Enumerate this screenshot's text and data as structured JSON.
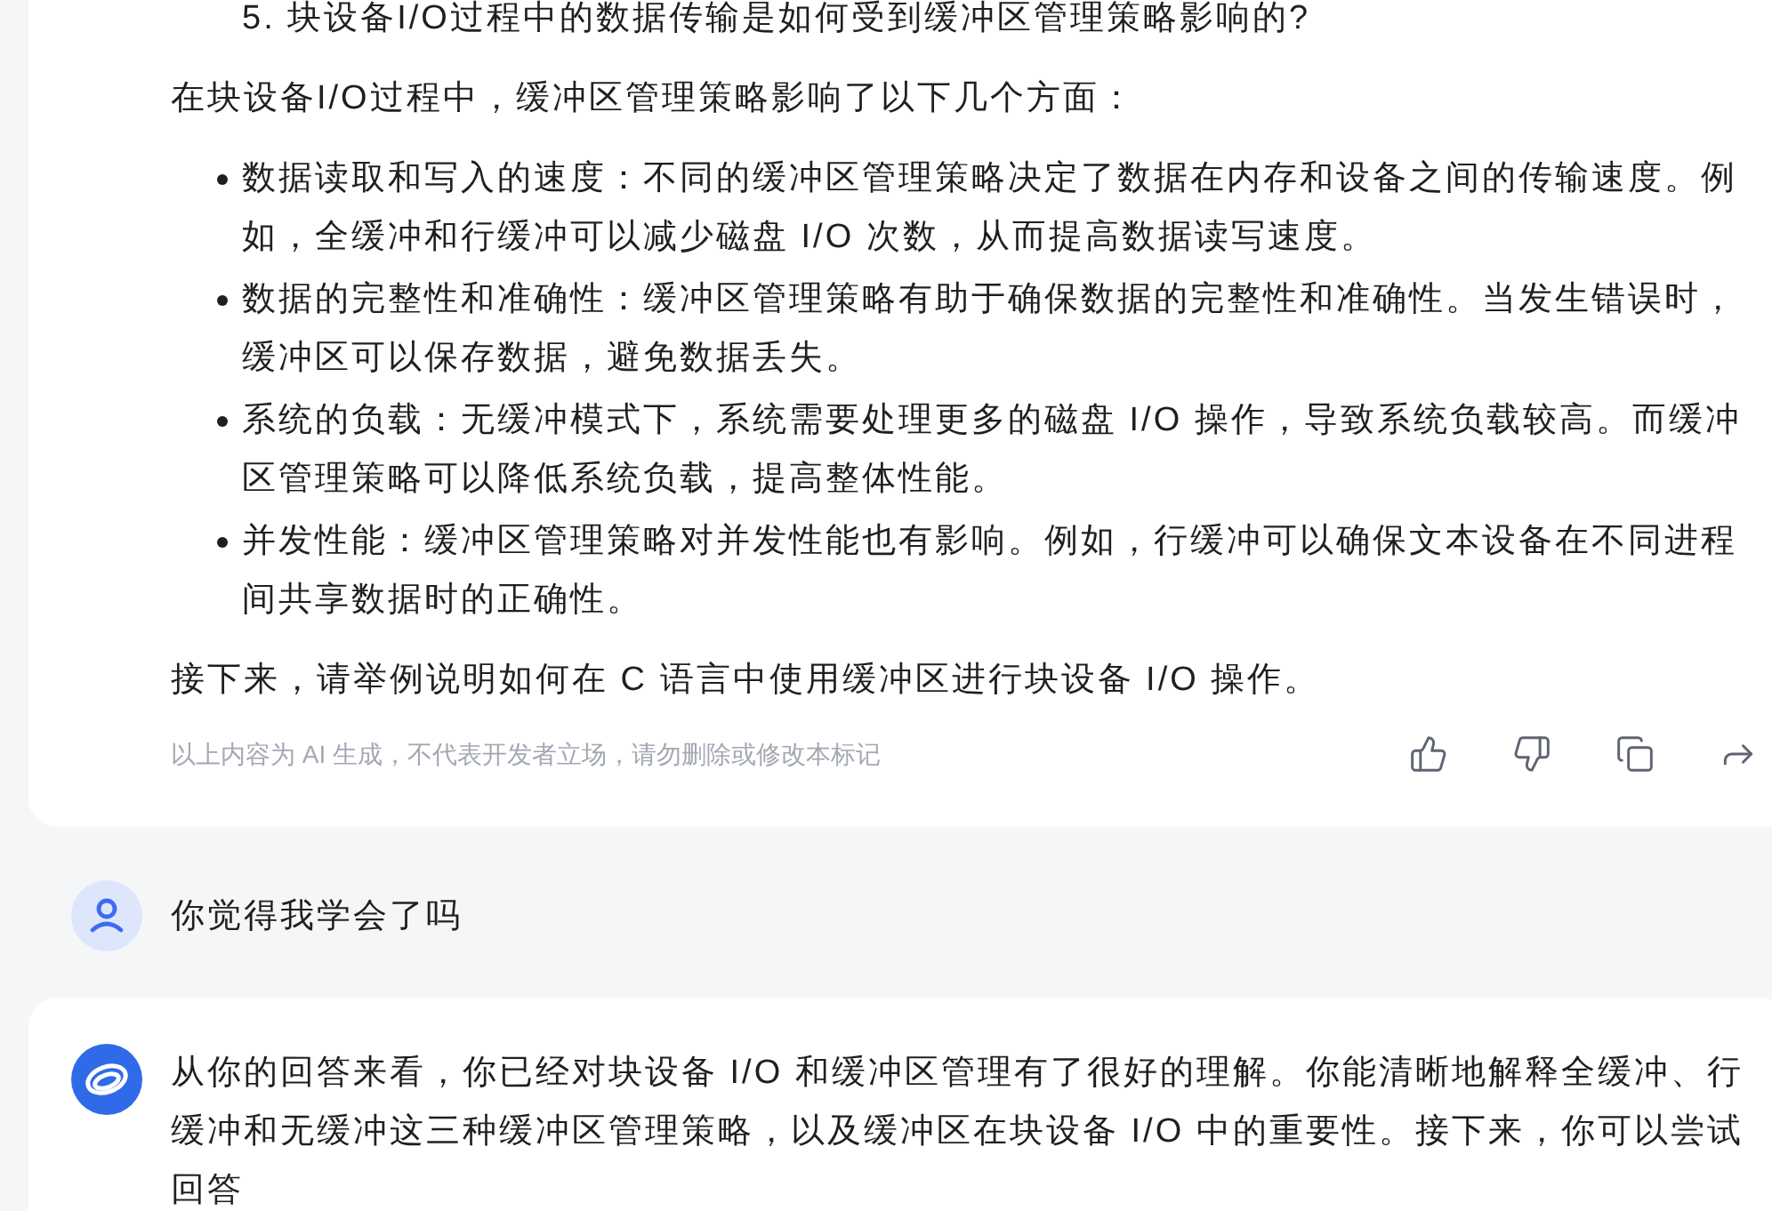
{
  "answer": {
    "heading": "5. 块设备I/O过程中的数据传输是如何受到缓冲区管理策略影响的?",
    "intro": "在块设备I/O过程中，缓冲区管理策略影响了以下几个方面：",
    "bullets": [
      "数据读取和写入的速度：不同的缓冲区管理策略决定了数据在内存和设备之间的传输速度。例如，全缓冲和行缓冲可以减少磁盘 I/O 次数，从而提高数据读写速度。",
      "数据的完整性和准确性：缓冲区管理策略有助于确保数据的完整性和准确性。当发生错误时，缓冲区可以保存数据，避免数据丢失。",
      "系统的负载：无缓冲模式下，系统需要处理更多的磁盘 I/O 操作，导致系统负载较高。而缓冲区管理策略可以降低系统负载，提高整体性能。",
      "并发性能：缓冲区管理策略对并发性能也有影响。例如，行缓冲可以确保文本设备在不同进程间共享数据时的正确性。"
    ],
    "closing": "接下来，请举例说明如何在 C 语言中使用缓冲区进行块设备 I/O 操作。",
    "disclaimer": "以上内容为 AI 生成，不代表开发者立场，请勿删除或修改本标记",
    "actions": [
      {
        "kind": "like"
      },
      {
        "kind": "dislike"
      },
      {
        "kind": "copy"
      },
      {
        "kind": "share"
      }
    ]
  },
  "user_message": {
    "text": "你觉得我学会了吗"
  },
  "reply": {
    "text": "从你的回答来看，你已经对块设备 I/O 和缓冲区管理有了很好的理解。你能清晰地解释全缓冲、行缓冲和无缓冲这三种缓冲区管理策略，以及缓冲区在块设备 I/O 中的重要性。接下来，你可以尝试回答"
  }
}
